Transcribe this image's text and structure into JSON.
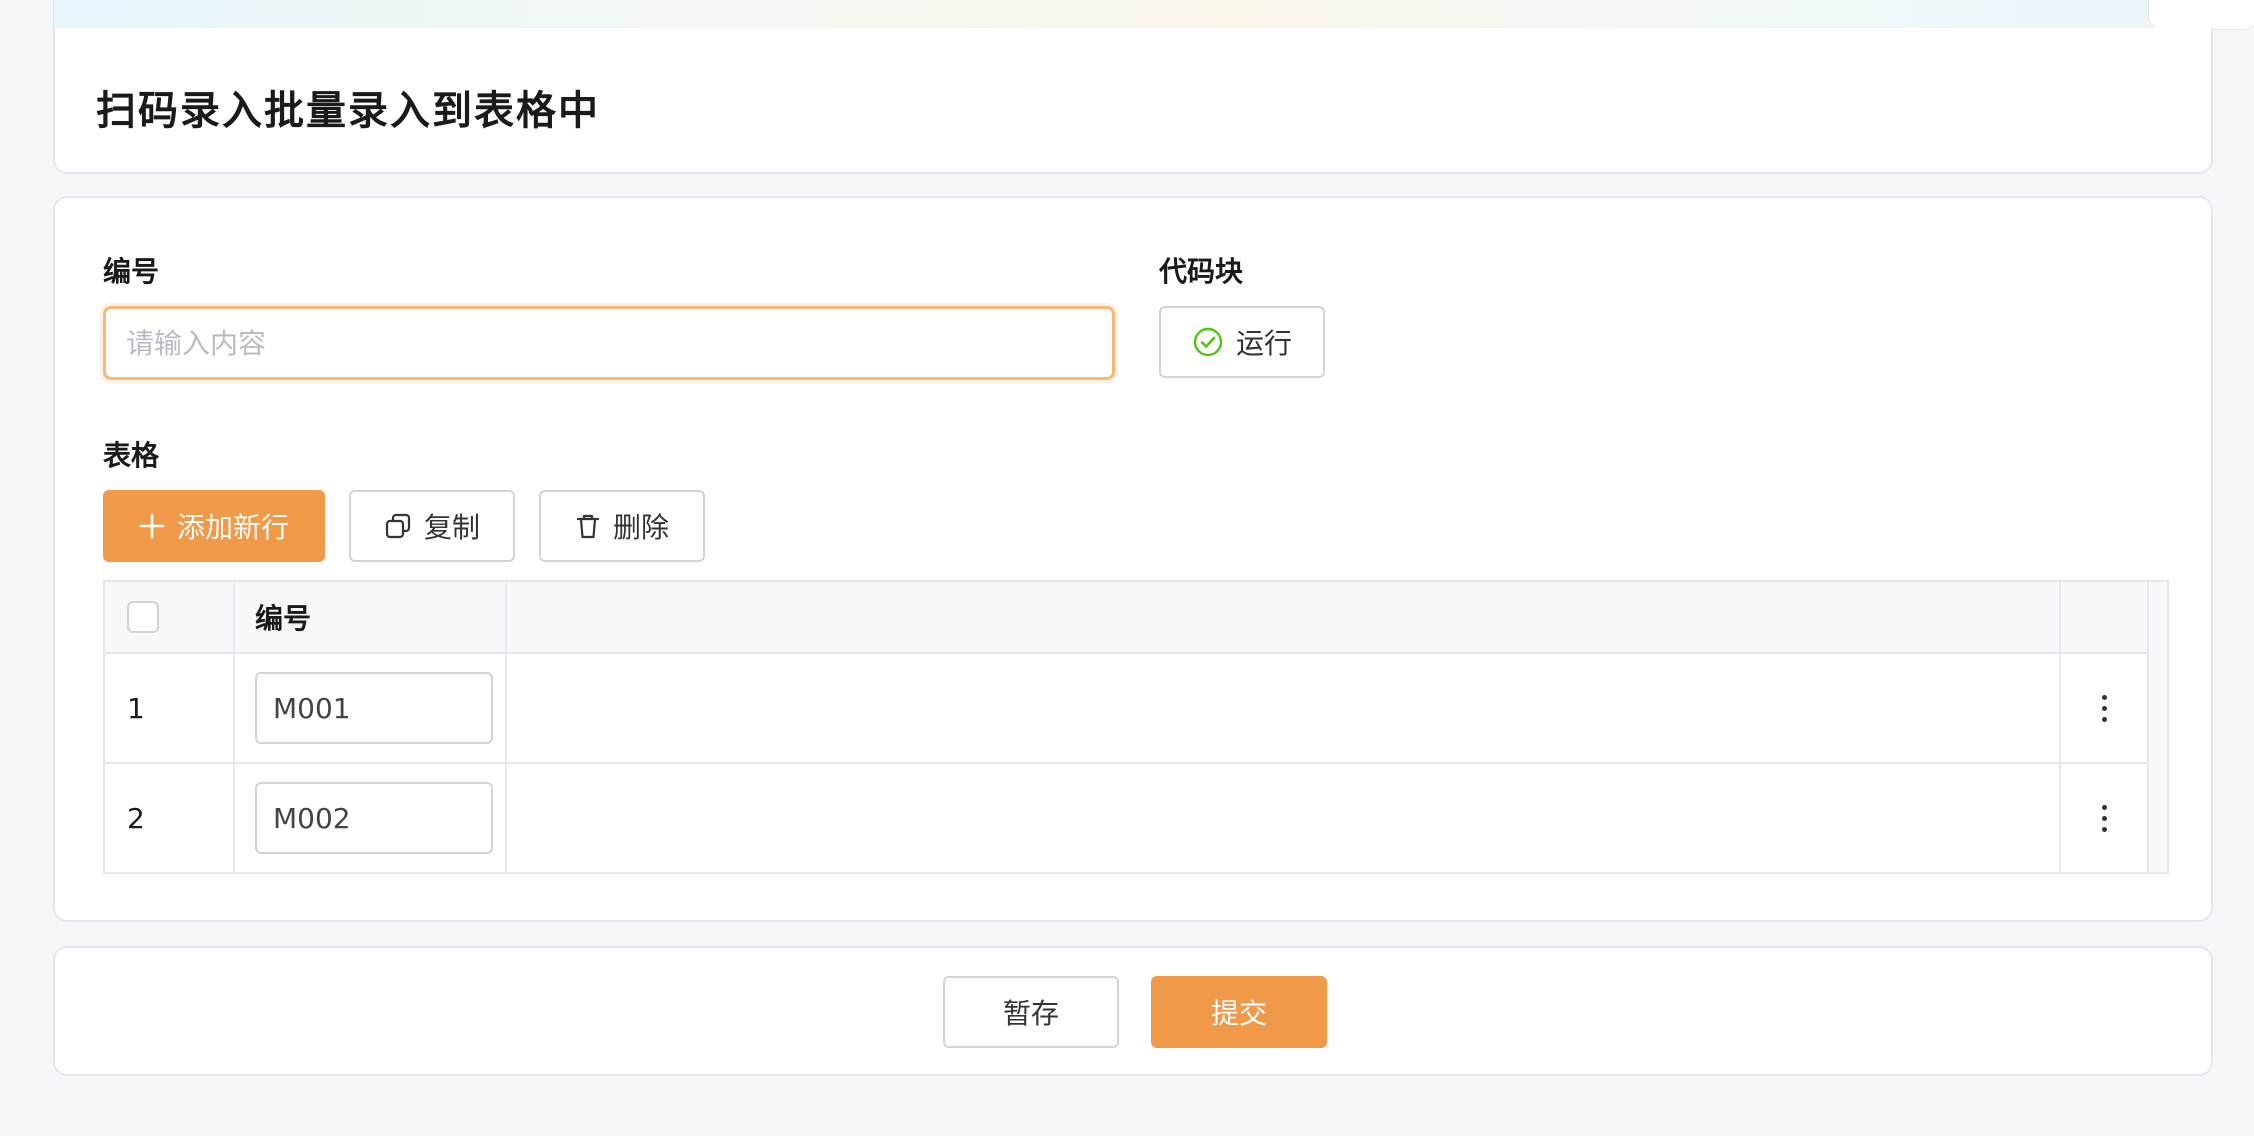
{
  "page": {
    "title": "扫码录入批量录入到表格中"
  },
  "form": {
    "number_label": "编号",
    "number_placeholder": "请输入内容",
    "number_value": "",
    "code_block_label": "代码块",
    "run_label": "运行",
    "table_label": "表格"
  },
  "table_toolbar": {
    "add_row_label": "添加新行",
    "copy_label": "复制",
    "delete_label": "删除"
  },
  "table": {
    "header": {
      "number": "编号"
    },
    "rows": [
      {
        "index": "1",
        "number": "M001"
      },
      {
        "index": "2",
        "number": "M002"
      }
    ]
  },
  "actions": {
    "save_label": "暂存",
    "submit_label": "提交"
  },
  "colors": {
    "primary": "#f09a49",
    "focus_border": "#f2b979",
    "success_icon": "#52c41a"
  },
  "icons": {
    "run": "check-circle-icon",
    "add": "plus-icon",
    "copy": "copy-icon",
    "delete": "trash-icon",
    "row_menu": "more-vertical-icon"
  }
}
